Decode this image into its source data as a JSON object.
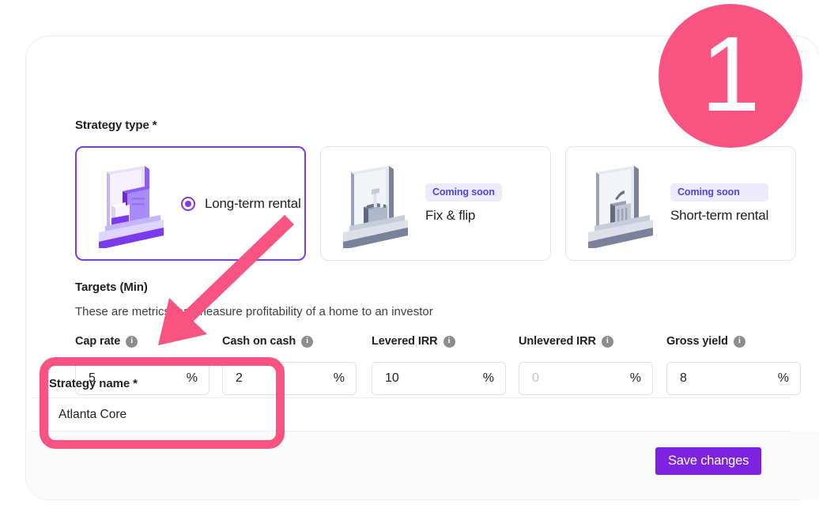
{
  "form": {
    "strategy_type": {
      "label": "Strategy type *",
      "options": [
        {
          "name": "Long-term rental",
          "badge": null,
          "selected": true,
          "art": "house-box-isometric-icon"
        },
        {
          "name": "Fix & flip",
          "badge": "Coming soon",
          "selected": false,
          "art": "house-toolbox-isometric-icon"
        },
        {
          "name": "Short-term rental",
          "badge": "Coming soon",
          "selected": false,
          "art": "house-suitcase-isometric-icon"
        }
      ]
    },
    "targets": {
      "label": "Targets (Min)",
      "description": "These are metrics that measure profitability of a home to an investor",
      "fields": [
        {
          "label": "Cap rate",
          "value": "5",
          "placeholder": "",
          "unit": "%",
          "is_placeholder": false
        },
        {
          "label": "Cash on cash",
          "value": "2",
          "placeholder": "",
          "unit": "%",
          "is_placeholder": false
        },
        {
          "label": "Levered IRR",
          "value": "10",
          "placeholder": "",
          "unit": "%",
          "is_placeholder": false
        },
        {
          "label": "Unlevered IRR",
          "value": "0",
          "placeholder": "0",
          "unit": "%",
          "is_placeholder": true
        },
        {
          "label": "Gross yield",
          "value": "8",
          "placeholder": "",
          "unit": "%",
          "is_placeholder": false
        }
      ]
    },
    "strategy_name": {
      "label": "Strategy name *",
      "value": "Atlanta Core",
      "placeholder": "Strategy name"
    },
    "save_button_label": "Save changes"
  },
  "annotations": {
    "step_number": "1",
    "badge_color": "#f95481",
    "highlight_color": "#f95481",
    "arrow_color": "#f95481"
  },
  "theme": {
    "accent": "#7c3aed",
    "save_button": "#7c22e0",
    "badge_bg": "#eceafb",
    "badge_text": "#4f46e5"
  }
}
